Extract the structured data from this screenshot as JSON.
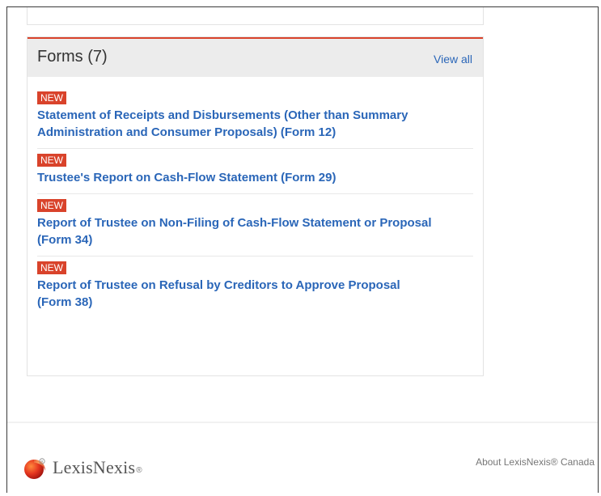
{
  "forms": {
    "title": "Forms (7)",
    "view_all_label": "View all",
    "badge_label": "NEW",
    "items": [
      {
        "badge": "NEW",
        "title": "Statement of Receipts and Disbursements (Other than Summary Administration and Consumer Proposals) (Form 12)"
      },
      {
        "badge": "NEW",
        "title": "Trustee's Report on Cash-Flow Statement (Form 29)"
      },
      {
        "badge": "NEW",
        "title": "Report of Trustee on Non-Filing of Cash-Flow Statement or Proposal (Form 34)"
      },
      {
        "badge": "NEW",
        "title": "Report of Trustee on Refusal by Creditors to Approve Proposal (Form 38)"
      }
    ]
  },
  "footer": {
    "logo_text": "LexisNexis",
    "logo_reg": "®",
    "about_label": "About LexisNexis® Canada"
  },
  "colors": {
    "accent": "#d9432b",
    "link": "#2a66b8",
    "header_bg": "#ececec"
  }
}
